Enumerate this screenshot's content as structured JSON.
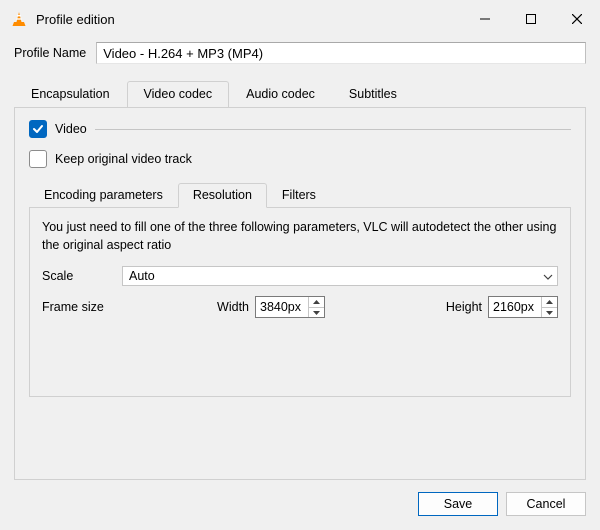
{
  "window": {
    "title": "Profile edition"
  },
  "profile": {
    "name_label": "Profile Name",
    "name_value": "Video - H.264 + MP3 (MP4)"
  },
  "outer_tabs": {
    "encapsulation": "Encapsulation",
    "video_codec": "Video codec",
    "audio_codec": "Audio codec",
    "subtitles": "Subtitles",
    "active": "video_codec"
  },
  "video": {
    "checkbox_label": "Video",
    "checked": true,
    "keep_original_label": "Keep original video track",
    "keep_original_checked": false
  },
  "inner_tabs": {
    "encoding": "Encoding parameters",
    "resolution": "Resolution",
    "filters": "Filters",
    "active": "resolution"
  },
  "resolution": {
    "hint": "You just need to fill one of the three following parameters, VLC will autodetect the other using the original aspect ratio",
    "scale_label": "Scale",
    "scale_value": "Auto",
    "frame_size_label": "Frame size",
    "width_label": "Width",
    "width_value": "3840px",
    "height_label": "Height",
    "height_value": "2160px"
  },
  "buttons": {
    "save": "Save",
    "cancel": "Cancel"
  },
  "colors": {
    "accent": "#0067c0"
  }
}
